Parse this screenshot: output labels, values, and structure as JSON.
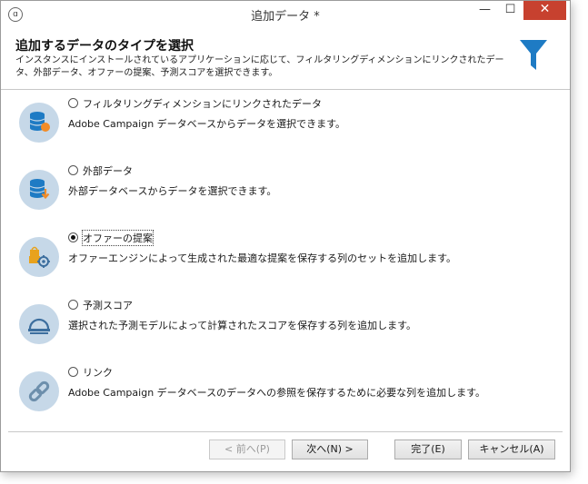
{
  "window": {
    "title": "追加データ *"
  },
  "titlebar_buttons": {
    "minimize": "—",
    "maximize": "☐",
    "close": "✕"
  },
  "header": {
    "title": "追加するデータのタイプを選択",
    "description": "インスタンスにインストールされているアプリケーションに応じて、フィルタリングディメンションにリンクされたデータ、外部データ、オファーの提案、予測スコアを選択できます。"
  },
  "options": [
    {
      "label": "フィルタリングディメンションにリンクされたデータ",
      "description": "Adobe Campaign データベースからデータを選択できます。",
      "icon": "database-icon",
      "selected": false
    },
    {
      "label": "外部データ",
      "description": "外部データベースからデータを選択できます。",
      "icon": "external-database-icon",
      "selected": false
    },
    {
      "label": "オファーの提案",
      "description": "オファーエンジンによって生成された最適な提案を保存する列のセットを追加します。",
      "icon": "offer-icon",
      "selected": true
    },
    {
      "label": "予測スコア",
      "description": "選択された予測モデルによって計算されたスコアを保存する列を追加します。",
      "icon": "score-icon",
      "selected": false
    },
    {
      "label": "リンク",
      "description": "Adobe Campaign データベースのデータへの参照を保存するために必要な列を追加します。",
      "icon": "link-icon",
      "selected": false
    }
  ],
  "footer": {
    "back_label": "< 前へ(P)",
    "next_label": "次へ(N) >",
    "finish_label": "完了(E)",
    "cancel_label": "キャンセル(A)"
  },
  "colors": {
    "accent": "#1e7bc4",
    "icon_bg": "#c6d8e8",
    "close": "#c7412f"
  }
}
